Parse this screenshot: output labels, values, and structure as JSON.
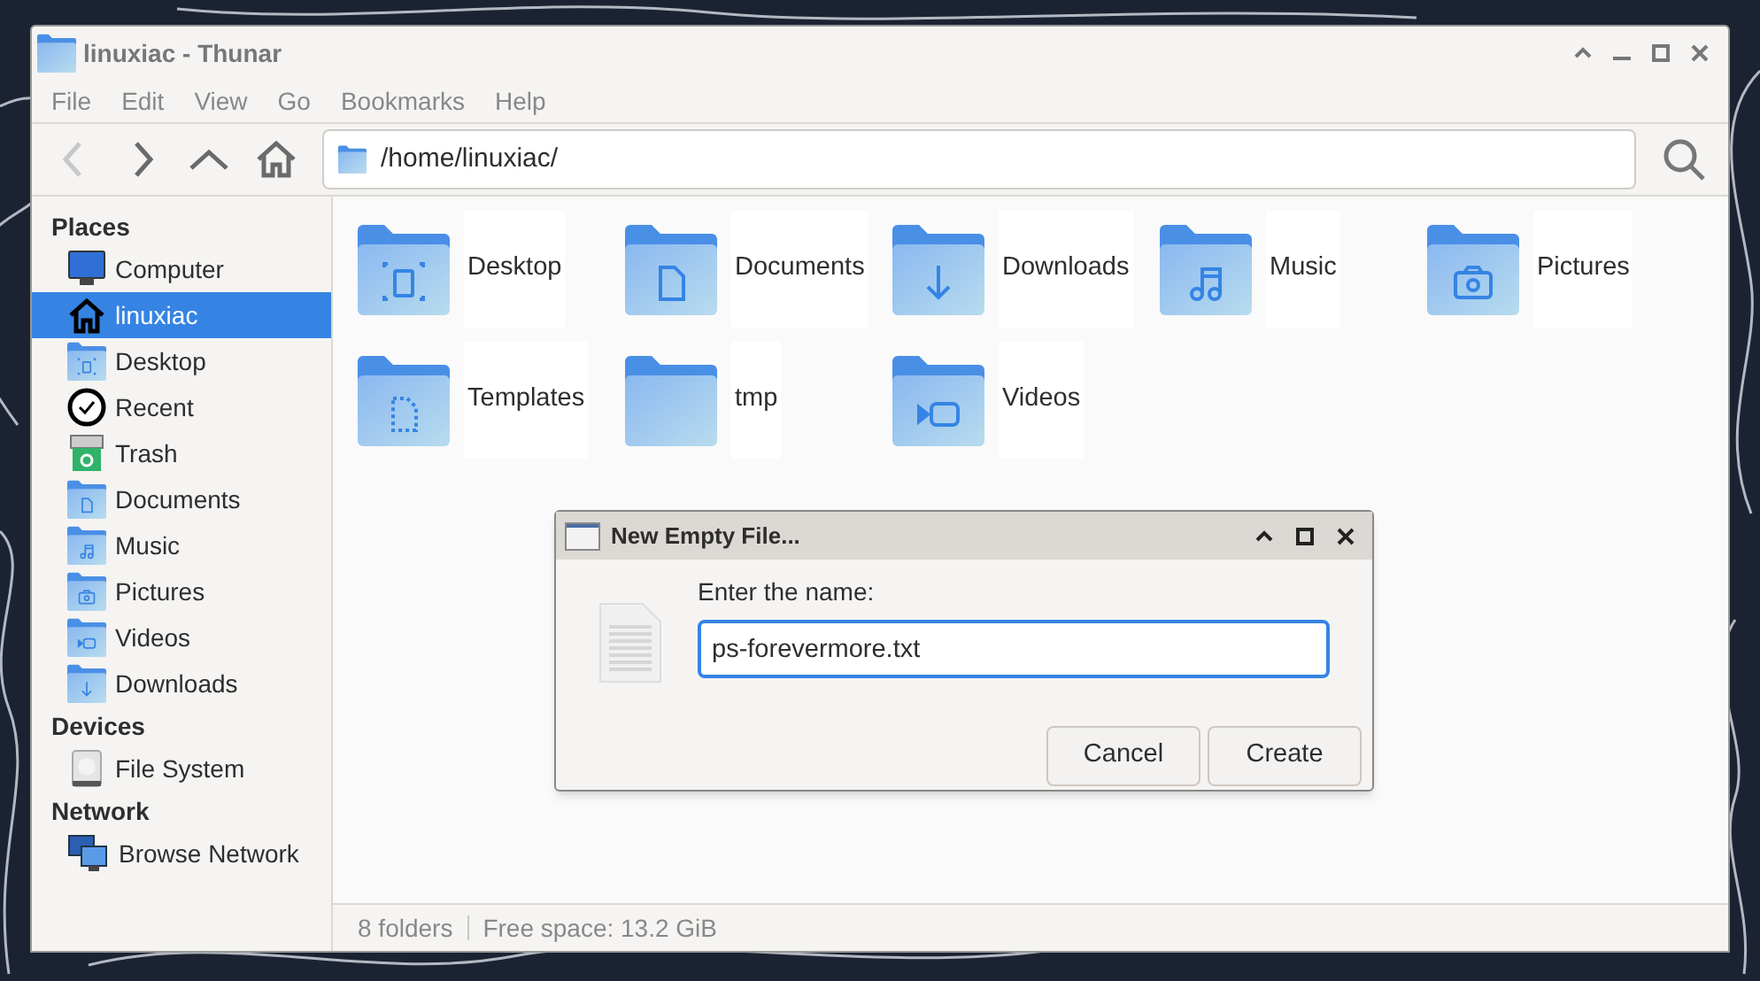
{
  "window": {
    "title": "linuxiac - Thunar"
  },
  "menu": [
    "File",
    "Edit",
    "View",
    "Go",
    "Bookmarks",
    "Help"
  ],
  "toolbar": {
    "buttons": [
      {
        "kind": "back",
        "disabled": true
      },
      {
        "kind": "forward",
        "disabled": false
      },
      {
        "kind": "up",
        "disabled": false
      },
      {
        "kind": "home",
        "disabled": false
      }
    ],
    "location": "/home/linuxiac/"
  },
  "sidebar": {
    "sections": [
      {
        "title": "Places",
        "items": [
          {
            "label": "Computer",
            "kind": "computer",
            "selected": false
          },
          {
            "label": "linuxiac",
            "kind": "home",
            "selected": true
          },
          {
            "label": "Desktop",
            "kind": "desktop",
            "selected": false
          },
          {
            "label": "Recent",
            "kind": "recent",
            "selected": false
          },
          {
            "label": "Trash",
            "kind": "trash",
            "selected": false
          },
          {
            "label": "Documents",
            "kind": "documents",
            "selected": false
          },
          {
            "label": "Music",
            "kind": "music",
            "selected": false
          },
          {
            "label": "Pictures",
            "kind": "pictures",
            "selected": false
          },
          {
            "label": "Videos",
            "kind": "videos",
            "selected": false
          },
          {
            "label": "Downloads",
            "kind": "downloads",
            "selected": false
          }
        ]
      },
      {
        "title": "Devices",
        "items": [
          {
            "label": "File System",
            "kind": "drive",
            "selected": false
          }
        ]
      },
      {
        "title": "Network",
        "items": [
          {
            "label": "Browse Network",
            "kind": "network",
            "selected": false
          }
        ]
      }
    ]
  },
  "folders": [
    {
      "name": "Desktop",
      "kind": "desktop"
    },
    {
      "name": "Documents",
      "kind": "documents"
    },
    {
      "name": "Downloads",
      "kind": "downloads"
    },
    {
      "name": "Music",
      "kind": "music"
    },
    {
      "name": "Pictures",
      "kind": "pictures"
    },
    {
      "name": "Templates",
      "kind": "templates"
    },
    {
      "name": "tmp",
      "kind": "plain"
    },
    {
      "name": "Videos",
      "kind": "videos"
    }
  ],
  "status_bar": {
    "count": "8 folders",
    "free_space": "Free space: 13.2 GiB"
  },
  "dialog": {
    "title": "New Empty File...",
    "prompt": "Enter the name:",
    "value": "ps-forevermore.txt",
    "buttons": [
      "Cancel",
      "Create"
    ]
  }
}
